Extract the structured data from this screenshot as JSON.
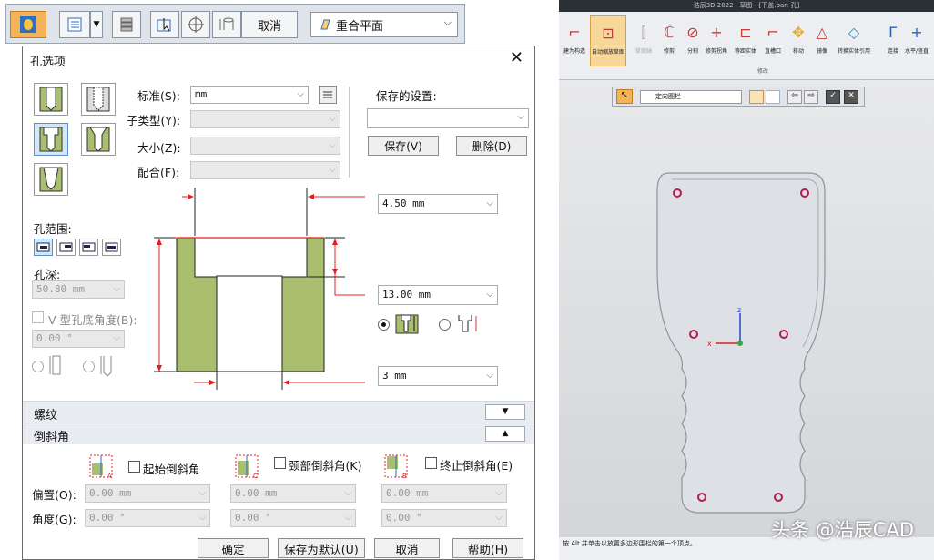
{
  "toolbar": {
    "cancel_label": "取消",
    "plane_label": "重合平面"
  },
  "dialog": {
    "title": "孔选项",
    "standard_label": "标准(S):",
    "standard_value": "mm",
    "subtype_label": "子类型(Y):",
    "size_label": "大小(Z):",
    "fit_label": "配合(F):",
    "saved_settings_label": "保存的设置:",
    "save_button": "保存(V)",
    "delete_button": "删除(D)",
    "hole_extent_label": "孔范围:",
    "hole_depth_label": "孔深:",
    "hole_depth_value": "50.80 mm",
    "v_bottom_label": "V 型孔底角度(B):",
    "v_bottom_value": "0.00 °",
    "dim_top_value": "4.50 mm",
    "dim_mid_value": "13.00 mm",
    "dim_bottom_value": "3 mm",
    "thread_section": "螺纹",
    "chamfer_section": "倒斜角",
    "start_chamfer_label": "起始倒斜角",
    "neck_chamfer_label": "颈部倒斜角(K)",
    "end_chamfer_label": "终止倒斜角(E)",
    "offset_label": "偏置(O):",
    "angle_label": "角度(G):",
    "offset_value": "0.00 mm",
    "angle_value": "0.00 °",
    "ok_button": "确定",
    "save_default_button": "保存为默认(U)",
    "cancel_button": "取消",
    "help_button": "帮助(H)"
  },
  "cad": {
    "window_title": "浩辰3D 2022 - 草图 - [下盖.par: 孔]",
    "ribbon_items": [
      "建为构造",
      "自动缩放草图",
      "草图轴",
      "修剪",
      "分割",
      "修剪拐角",
      "等距实体",
      "直槽口",
      "移动",
      "镜像",
      "转换实体引用",
      "连接",
      "水平/竖直"
    ],
    "ribbon_group": "修改",
    "orient_label": "定向图栏",
    "status_text": "按 Alt 并单击以放置多边形围栏的第一个顶点。",
    "watermark": "头条 @浩辰CAD"
  },
  "colors": {
    "accent_orange": "#f2b35a",
    "hole_fill": "#a9bf6f",
    "dimension_red": "#e02020",
    "select_blue": "#d4e6f9"
  }
}
